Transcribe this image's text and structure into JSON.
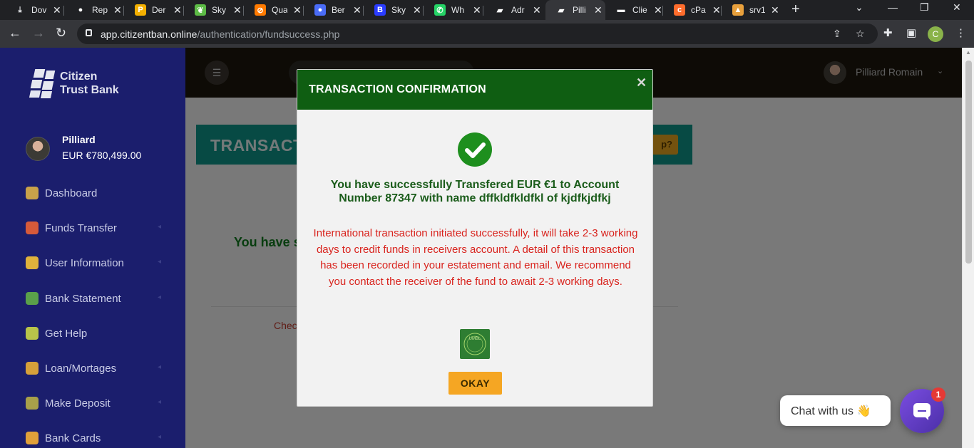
{
  "browser": {
    "tabs": [
      {
        "title": "Dov",
        "icon": "download-icon",
        "color": "#202124",
        "glyph": "⤓"
      },
      {
        "title": "Rep",
        "icon": "github-icon",
        "color": "#ffffff",
        "glyph": "●"
      },
      {
        "title": "Der",
        "icon": "p-logo-icon",
        "color": "#f4b000",
        "glyph": "P"
      },
      {
        "title": "Sky",
        "icon": "leaf-icon",
        "color": "#5dbb46",
        "glyph": "❦"
      },
      {
        "title": "Qua",
        "icon": "quad-icon",
        "color": "#ff7a00",
        "glyph": "⊘"
      },
      {
        "title": "Ber",
        "icon": "ber-icon",
        "color": "#4a6cf7",
        "glyph": "●"
      },
      {
        "title": "Sky",
        "icon": "b-logo-icon",
        "color": "#2a3cff",
        "glyph": "B"
      },
      {
        "title": "Wh",
        "icon": "whatsapp-icon",
        "color": "#25d366",
        "glyph": "✆"
      },
      {
        "title": "Adr",
        "icon": "bank-logo-icon",
        "color": "#ffffff",
        "glyph": "▰"
      },
      {
        "title": "Pilli",
        "icon": "bank-logo-icon",
        "color": "#ffffff",
        "glyph": "▰",
        "active": true
      },
      {
        "title": "Clie",
        "icon": "client-icon",
        "color": "#ffffff",
        "glyph": "▬"
      },
      {
        "title": "cPa",
        "icon": "cpanel-icon",
        "color": "#ff6c2c",
        "glyph": "c"
      },
      {
        "title": "srv1",
        "icon": "srv-icon",
        "color": "#e8a03c",
        "glyph": "▲"
      }
    ],
    "url_host": "app.citizentban.online",
    "url_path": "/authentication/fundsuccess.php",
    "profile_initial": "C"
  },
  "sidebar": {
    "brand_line1": "Citizen",
    "brand_line2": "Trust Bank",
    "user_name": "Pilliard",
    "balance": "EUR €780,499.00",
    "items": [
      {
        "label": "Dashboard",
        "icon": "bank-icon",
        "color": "#c9a24a"
      },
      {
        "label": "Funds Transfer",
        "icon": "money-bag-icon",
        "color": "#d65a3a"
      },
      {
        "label": "User Information",
        "icon": "user-key-icon",
        "color": "#e0b23c"
      },
      {
        "label": "Bank Statement",
        "icon": "chart-icon",
        "color": "#5aa04a"
      },
      {
        "label": "Get Help",
        "icon": "help-icon",
        "color": "#b8c44a"
      },
      {
        "label": "Loan/Mortages",
        "icon": "coin-icon",
        "color": "#d6a03a"
      },
      {
        "label": "Make Deposit",
        "icon": "deposit-icon",
        "color": "#a8a04a"
      },
      {
        "label": "Bank Cards",
        "icon": "card-icon",
        "color": "#e0a03a"
      }
    ]
  },
  "topbar": {
    "user_name": "Pilliard Romain"
  },
  "background": {
    "banner_title": "TRANSACT",
    "banner_button": "p?",
    "success_text": "You have s",
    "link_text": "Chec"
  },
  "modal": {
    "title": "TRANSACTION CONFIRMATION",
    "close": "✕",
    "success_message": "You have successfully Transfered EUR €1 to Account Number 87347 with name dffkldfkldfkl of kjdfkjdfkj",
    "detail_message": "International transaction initiated successfully, it will take 2-3 working days to credit funds in receivers account. A detail of this transaction has been recorded in your estatement and email. We recommend you contact the receiver of the fund to await 2-3 working days.",
    "ok_label": "OKAY",
    "seal_text": "UMBL"
  },
  "chat": {
    "label": "Chat with us 👋",
    "badge": "1"
  }
}
